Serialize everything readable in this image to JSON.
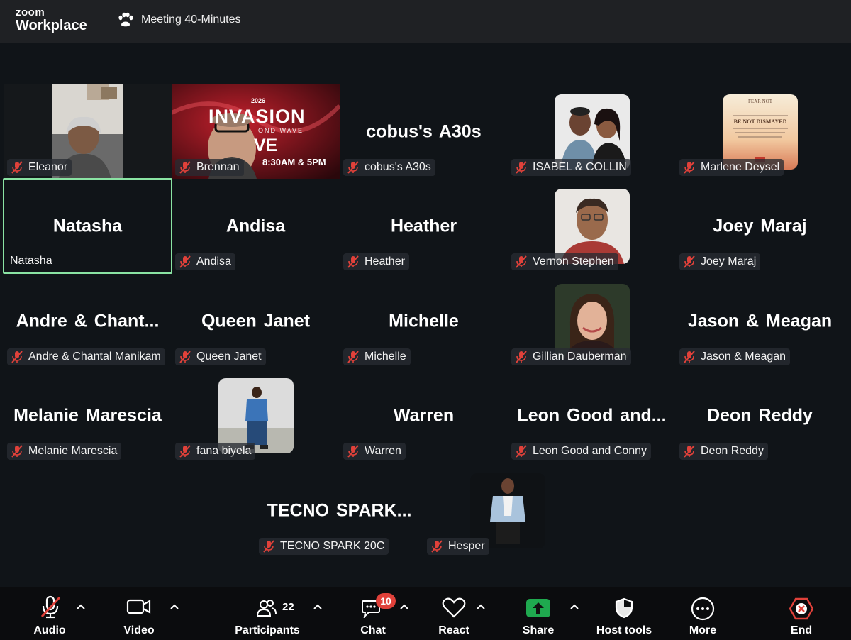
{
  "header": {
    "brand_small": "zoom",
    "brand_large": "Workplace",
    "meeting_title": "Meeting 40-Minutes"
  },
  "tiles": [
    {
      "name": "Eleanor",
      "display": "",
      "type": "video"
    },
    {
      "name": "Brennan",
      "display": "",
      "type": "video",
      "banner_text": "2026",
      "banner_big": "INVASION",
      "banner_sub": "OND WAVE",
      "banner_ve": "VE",
      "banner_time": "8:30AM & 5PM"
    },
    {
      "name": "cobus's A30s",
      "display": "cobus's A30s",
      "type": "name"
    },
    {
      "name": "ISABEL & COLLIN",
      "display": "",
      "type": "avatar"
    },
    {
      "name": "Marlene Deysel",
      "display": "",
      "type": "avatar",
      "poster_title": "FEAR NOT",
      "poster_line": "BE NOT DISMAYED"
    },
    {
      "name": "Natasha",
      "display": "Natasha",
      "type": "name"
    },
    {
      "name": "Andisa",
      "display": "Andisa",
      "type": "name"
    },
    {
      "name": "Heather",
      "display": "Heather",
      "type": "name"
    },
    {
      "name": "Vernon Stephen",
      "display": "",
      "type": "avatar"
    },
    {
      "name": "Joey Maraj",
      "display": "Joey Maraj",
      "type": "name"
    },
    {
      "name": "Andre & Chantal Manikam",
      "display": "Andre & Chant...",
      "type": "name"
    },
    {
      "name": "Queen Janet",
      "display": "Queen Janet",
      "type": "name"
    },
    {
      "name": "Michelle",
      "display": "Michelle",
      "type": "name"
    },
    {
      "name": "Gillian Dauberman",
      "display": "",
      "type": "avatar"
    },
    {
      "name": "Jason & Meagan",
      "display": "Jason & Meagan",
      "type": "name"
    },
    {
      "name": "Melanie Marescia",
      "display": "Melanie Marescia",
      "type": "name"
    },
    {
      "name": "fana biyela",
      "display": "",
      "type": "avatar"
    },
    {
      "name": "Warren",
      "display": "Warren",
      "type": "name"
    },
    {
      "name": "Leon Good and Conny",
      "display": "Leon Good and...",
      "type": "name"
    },
    {
      "name": "Deon Reddy",
      "display": "Deon Reddy",
      "type": "name"
    },
    {
      "name": "TECNO SPARK 20C",
      "display": "TECNO SPARK...",
      "type": "name"
    },
    {
      "name": "Hesper",
      "display": "",
      "type": "avatar"
    }
  ],
  "toolbar": {
    "audio": "Audio",
    "video": "Video",
    "participants": "Participants",
    "participants_count": "22",
    "chat": "Chat",
    "chat_badge": "10",
    "react": "React",
    "share": "Share",
    "host_tools": "Host tools",
    "more": "More",
    "end": "End"
  },
  "colors": {
    "active_speaker_border": "#8ae3a3",
    "share_green": "#1fa94f",
    "end_red": "#e0413a",
    "badge_red": "#e0413a",
    "muted_red": "#e0413a"
  }
}
